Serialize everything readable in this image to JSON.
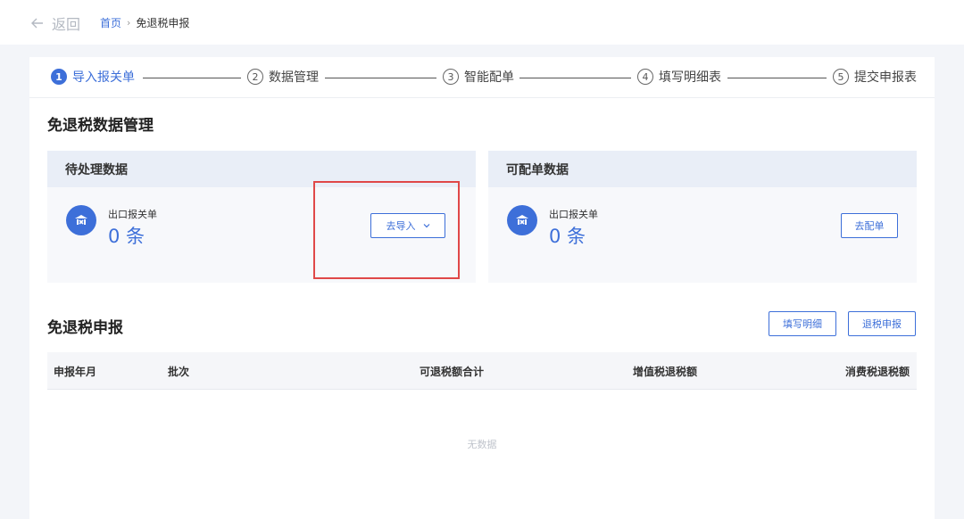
{
  "header": {
    "back_label": "返回",
    "breadcrumb": {
      "home": "首页",
      "separator": "›",
      "current": "免退税申报"
    }
  },
  "steps": [
    {
      "num": "1",
      "label": "导入报关单",
      "active": true
    },
    {
      "num": "2",
      "label": "数据管理",
      "active": false
    },
    {
      "num": "3",
      "label": "智能配单",
      "active": false
    },
    {
      "num": "4",
      "label": "填写明细表",
      "active": false
    },
    {
      "num": "5",
      "label": "提交申报表",
      "active": false
    }
  ],
  "data_section": {
    "title": "免退税数据管理",
    "pending": {
      "title": "待处理数据",
      "item_label": "出口报关单",
      "count": "0 条",
      "button_label": "去导入"
    },
    "matchable": {
      "title": "可配单数据",
      "item_label": "出口报关单",
      "count": "0 条",
      "button_label": "去配单"
    }
  },
  "declaration_section": {
    "title": "免退税申报",
    "fill_detail_button": "填写明细",
    "tax_refund_button": "退税申报",
    "columns": [
      "申报年月",
      "批次",
      "可退税额合计",
      "增值税退税额",
      "消费税退税额"
    ],
    "empty_text": "无数据"
  },
  "colors": {
    "accent": "#3d6fd9",
    "highlight_border": "#e04848",
    "panel_header": "#e9eef7"
  },
  "icons": {
    "back": "arrow-left-icon",
    "step_number": "circled-number-icon",
    "customs": "customs-declaration-icon",
    "dropdown": "chevron-down-icon"
  }
}
